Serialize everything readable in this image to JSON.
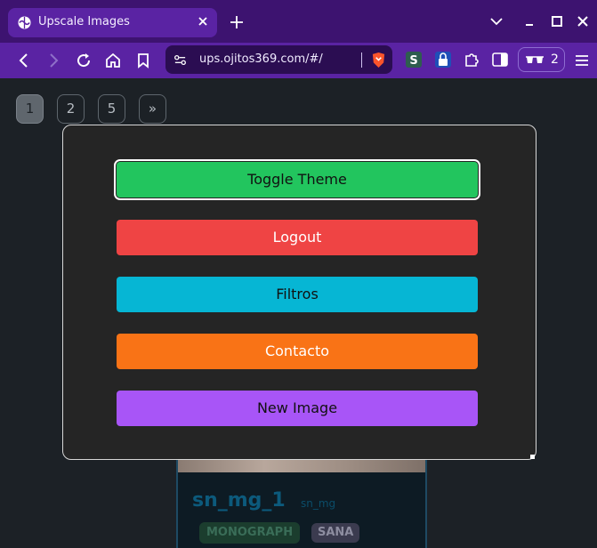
{
  "browser": {
    "tab": {
      "title": "Upscale Images"
    },
    "address": "ups.ojitos369.com/#/",
    "profile": {
      "count": "2"
    }
  },
  "page": {
    "pagination": [
      "1",
      "2",
      "5",
      "»"
    ],
    "card": {
      "title": "sn_mg_1",
      "subtitle": "sn_mg",
      "tags": [
        "MONOGRAPH",
        "SANA"
      ]
    }
  },
  "modal": {
    "buttons": {
      "toggle_theme": "Toggle Theme",
      "logout": "Logout",
      "filtros": "Filtros",
      "contacto": "Contacto",
      "new_image": "New Image"
    }
  },
  "colors": {
    "chrome_dark": "#3d1370",
    "chrome": "#5a23a3",
    "toggle_theme": "#22c55e",
    "logout": "#ef4444",
    "filtros": "#06b6d4",
    "contacto": "#f97316",
    "new_image": "#a855f7"
  },
  "icons": [
    "tab-favicon-icon",
    "close-icon",
    "plus-icon",
    "chevron-down-icon",
    "minimize-icon",
    "maximize-icon",
    "close-window-icon",
    "back-icon",
    "forward-icon",
    "reload-icon",
    "home-icon",
    "bookmark-icon",
    "site-settings-icon",
    "brave-shield-icon",
    "extension-s-icon",
    "extension-lock-icon",
    "puzzle-icon",
    "sidebar-icon",
    "glasses-icon",
    "menu-icon"
  ]
}
